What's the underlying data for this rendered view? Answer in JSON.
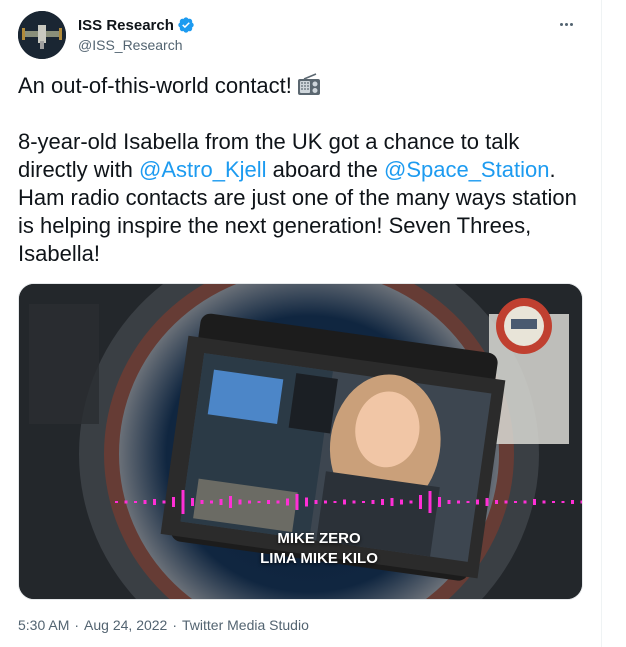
{
  "author": {
    "display_name": "ISS Research",
    "handle": "@ISS_Research",
    "verified": true
  },
  "tweet": {
    "line1": "An out-of-this-world contact!",
    "emoji_icon": "radio-icon",
    "para2_part1": "8-year-old Isabella from the UK got a chance to talk directly with ",
    "mention1": "@Astro_Kjell",
    "para2_part2": " aboard the ",
    "mention2": "@Space_Station",
    "para2_part3": ". Ham radio contacts are just one of the many ways station is helping inspire the next generation! Seven Threes, Isabella!"
  },
  "media": {
    "caption_line1": "MIKE ZERO",
    "caption_line2": "LIMA MIKE KILO",
    "waveform_color": "#ff2fd6"
  },
  "meta": {
    "time": "5:30 AM",
    "date": "Aug 24, 2022",
    "source": "Twitter Media Studio"
  },
  "colors": {
    "link": "#1d9bf0",
    "text": "#0f1419",
    "muted": "#536471"
  }
}
